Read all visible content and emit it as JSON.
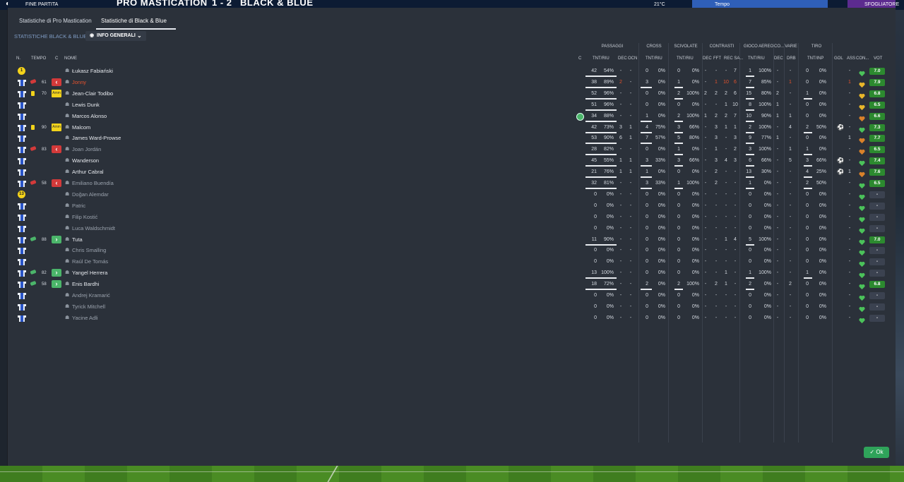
{
  "topbar": {
    "status": "FINE PARTITA",
    "home": "PRO MASTICATION",
    "score": "1 - 2",
    "away": "BLACK & BLUE",
    "right_a": "21°C",
    "right_b": "Tempo",
    "right_c": "SFOGLIATORE"
  },
  "tabs": [
    {
      "label": "Statistiche di Pro Mastication"
    },
    {
      "label": "Statistiche di Black & Blue"
    }
  ],
  "subtitle": "STATISTICHE BLACK & BLUE",
  "view_dropdown": {
    "label": "INFO GENERALI"
  },
  "groups": [
    "PASSAGGI",
    "CROSS",
    "SCIVOLATE",
    "CONTRASTI",
    "GIOCO AEREO",
    "CO...",
    "VARIE",
    "TIRO"
  ],
  "headers": {
    "n": "N.",
    "tempo": "TEMPO",
    "c": "C",
    "nome": "NOME",
    "c2": "C",
    "pass_tnt": "TNT/RIU",
    "pass_dec": "DEC",
    "pass_occ": "OCN",
    "cross": "TNT/RIU",
    "scivolate": "TNT/RIU",
    "con_dec": "DEC",
    "con_fft": "FFT",
    "con_rec": "REC SA...",
    "aereo": "TNT/RIU",
    "co_dec": "DEC",
    "varie": "DRB",
    "tiro": "TNT/INP",
    "gol": "GOL",
    "ass": "ASS",
    "con": "CON...",
    "vot": "VOT"
  },
  "players": [
    {
      "kit": "gk",
      "kitnum": "1",
      "time": "",
      "sub": "",
      "card": "",
      "name": "Łukasz Fabiański",
      "style": "",
      "p_t": "42",
      "p_r": "54%",
      "p_dec": "-",
      "p_occ": "-",
      "cr_t": "0",
      "cr_r": "0%",
      "sc_t": "0",
      "sc_r": "0%",
      "c_dec": "-",
      "c_fft": "-",
      "c_rec": "-",
      "c_sa": "7",
      "a_t": "1",
      "a_r": "100%",
      "co": "-",
      "drb": "-",
      "ti_t": "0",
      "ti_r": "0%",
      "gol": "",
      "ass": "-",
      "vot": "7.0",
      "heart": "green"
    },
    {
      "kit": "out",
      "kitnum": "",
      "time": "61",
      "sub": "out",
      "card": "",
      "name": "Jonny",
      "style": "red",
      "p_t": "38",
      "p_r": "89%",
      "p_dec": "2",
      "p_occ": "-",
      "cr_t": "3",
      "cr_r": "0%",
      "sc_t": "1",
      "sc_r": "0%",
      "c_dec": "-",
      "c_fft": "1",
      "c_rec": "10",
      "c_sa": "6",
      "a_t": "7",
      "a_r": "85%",
      "co": "-",
      "drb": "1",
      "ti_t": "0",
      "ti_r": "0%",
      "gol": "",
      "ass": "1",
      "vot": "7.9",
      "heart": "gold"
    },
    {
      "kit": "out",
      "kitnum": "",
      "time": "70",
      "sub": "amm",
      "card": "y",
      "name": "Jean-Clair Todibo",
      "style": "",
      "p_t": "52",
      "p_r": "96%",
      "p_dec": "-",
      "p_occ": "-",
      "cr_t": "0",
      "cr_r": "0%",
      "sc_t": "2",
      "sc_r": "100%",
      "c_dec": "2",
      "c_fft": "2",
      "c_rec": "2",
      "c_sa": "6",
      "a_t": "15",
      "a_r": "80%",
      "co": "2",
      "drb": "-",
      "ti_t": "1",
      "ti_r": "0%",
      "gol": "",
      "ass": "-",
      "vot": "6.8",
      "heart": "gold"
    },
    {
      "kit": "out",
      "kitnum": "",
      "time": "",
      "sub": "",
      "card": "",
      "name": "Lewis Dunk",
      "style": "",
      "p_t": "51",
      "p_r": "96%",
      "p_dec": "-",
      "p_occ": "-",
      "cr_t": "0",
      "cr_r": "0%",
      "sc_t": "0",
      "sc_r": "0%",
      "c_dec": "-",
      "c_fft": "-",
      "c_rec": "1",
      "c_sa": "10",
      "a_t": "8",
      "a_r": "100%",
      "co": "1",
      "drb": "-",
      "ti_t": "0",
      "ti_r": "0%",
      "gol": "",
      "ass": "-",
      "vot": "6.5",
      "heart": "gold"
    },
    {
      "kit": "out",
      "kitnum": "",
      "time": "",
      "sub": "",
      "card": "",
      "name": "Marcos Alonso",
      "style": "",
      "p_t": "34",
      "p_r": "88%",
      "p_dec": "-",
      "p_occ": "-",
      "cr_t": "1",
      "cr_r": "0%",
      "sc_t": "2",
      "sc_r": "100%",
      "c_dec": "1",
      "c_fft": "2",
      "c_rec": "2",
      "c_sa": "7",
      "a_t": "10",
      "a_r": "90%",
      "co": "1",
      "drb": "1",
      "ti_t": "0",
      "ti_r": "0%",
      "gol": "",
      "ass": "-",
      "vot": "6.6",
      "heart": "orange",
      "motm": true
    },
    {
      "kit": "out",
      "kitnum": "",
      "time": "90",
      "sub": "amm",
      "card": "y",
      "name": "Malcom",
      "style": "",
      "p_t": "42",
      "p_r": "73%",
      "p_dec": "3",
      "p_occ": "1",
      "cr_t": "4",
      "cr_r": "75%",
      "sc_t": "3",
      "sc_r": "66%",
      "c_dec": "-",
      "c_fft": "3",
      "c_rec": "1",
      "c_sa": "1",
      "a_t": "2",
      "a_r": "100%",
      "co": "-",
      "drb": "4",
      "ti_t": "2",
      "ti_r": "50%",
      "gol": "⚽",
      "ass": "-",
      "vot": "7.3",
      "heart": "green"
    },
    {
      "kit": "out",
      "kitnum": "",
      "time": "",
      "sub": "",
      "card": "",
      "name": "James Ward-Prowse",
      "style": "",
      "p_t": "53",
      "p_r": "90%",
      "p_dec": "6",
      "p_occ": "1",
      "cr_t": "7",
      "cr_r": "57%",
      "sc_t": "5",
      "sc_r": "80%",
      "c_dec": "-",
      "c_fft": "3",
      "c_rec": "-",
      "c_sa": "3",
      "a_t": "9",
      "a_r": "77%",
      "co": "1",
      "drb": "-",
      "ti_t": "0",
      "ti_r": "0%",
      "gol": "",
      "ass": "1",
      "vot": "7.7",
      "heart": "orange"
    },
    {
      "kit": "out",
      "kitnum": "",
      "time": "83",
      "sub": "out",
      "card": "",
      "name": "Joan Jordán",
      "style": "dim",
      "p_t": "28",
      "p_r": "82%",
      "p_dec": "-",
      "p_occ": "-",
      "cr_t": "0",
      "cr_r": "0%",
      "sc_t": "1",
      "sc_r": "0%",
      "c_dec": "-",
      "c_fft": "1",
      "c_rec": "-",
      "c_sa": "2",
      "a_t": "3",
      "a_r": "100%",
      "co": "-",
      "drb": "1",
      "ti_t": "1",
      "ti_r": "0%",
      "gol": "",
      "ass": "-",
      "vot": "6.5",
      "heart": "orange"
    },
    {
      "kit": "out",
      "kitnum": "",
      "time": "",
      "sub": "",
      "card": "",
      "name": "Wanderson",
      "style": "",
      "p_t": "45",
      "p_r": "55%",
      "p_dec": "1",
      "p_occ": "1",
      "cr_t": "3",
      "cr_r": "33%",
      "sc_t": "3",
      "sc_r": "66%",
      "c_dec": "-",
      "c_fft": "3",
      "c_rec": "4",
      "c_sa": "3",
      "a_t": "6",
      "a_r": "66%",
      "co": "-",
      "drb": "5",
      "ti_t": "3",
      "ti_r": "66%",
      "gol": "⚽",
      "ass": "-",
      "vot": "7.4",
      "heart": "green"
    },
    {
      "kit": "out",
      "kitnum": "",
      "time": "",
      "sub": "",
      "card": "",
      "name": "Arthur Cabral",
      "style": "",
      "p_t": "21",
      "p_r": "76%",
      "p_dec": "1",
      "p_occ": "1",
      "cr_t": "1",
      "cr_r": "0%",
      "sc_t": "0",
      "sc_r": "0%",
      "c_dec": "-",
      "c_fft": "2",
      "c_rec": "-",
      "c_sa": "-",
      "a_t": "13",
      "a_r": "30%",
      "co": "-",
      "drb": "-",
      "ti_t": "4",
      "ti_r": "25%",
      "gol": "⚽",
      "ass": "1",
      "vot": "7.6",
      "heart": "orange"
    },
    {
      "kit": "out",
      "kitnum": "",
      "time": "58",
      "sub": "out",
      "card": "",
      "name": "Emiliano Buendía",
      "style": "dim",
      "p_t": "32",
      "p_r": "81%",
      "p_dec": "-",
      "p_occ": "-",
      "cr_t": "3",
      "cr_r": "33%",
      "sc_t": "1",
      "sc_r": "100%",
      "c_dec": "-",
      "c_fft": "2",
      "c_rec": "-",
      "c_sa": "-",
      "a_t": "1",
      "a_r": "0%",
      "co": "-",
      "drb": "-",
      "ti_t": "2",
      "ti_r": "50%",
      "gol": "",
      "ass": "-",
      "vot": "6.5",
      "heart": "green"
    },
    {
      "kit": "gk",
      "kitnum": "13",
      "time": "",
      "sub": "",
      "card": "",
      "name": "Doğan Alemdar",
      "style": "dim",
      "p_t": "0",
      "p_r": "0%",
      "p_dec": "-",
      "p_occ": "-",
      "cr_t": "0",
      "cr_r": "0%",
      "sc_t": "0",
      "sc_r": "0%",
      "c_dec": "-",
      "c_fft": "-",
      "c_rec": "-",
      "c_sa": "-",
      "a_t": "0",
      "a_r": "0%",
      "co": "-",
      "drb": "-",
      "ti_t": "0",
      "ti_r": "0%",
      "gol": "",
      "ass": "-",
      "vot": "-",
      "heart": "green"
    },
    {
      "kit": "out",
      "kitnum": "",
      "time": "",
      "sub": "",
      "card": "",
      "name": "Patric",
      "style": "dim",
      "p_t": "0",
      "p_r": "0%",
      "p_dec": "-",
      "p_occ": "-",
      "cr_t": "0",
      "cr_r": "0%",
      "sc_t": "0",
      "sc_r": "0%",
      "c_dec": "-",
      "c_fft": "-",
      "c_rec": "-",
      "c_sa": "-",
      "a_t": "0",
      "a_r": "0%",
      "co": "-",
      "drb": "-",
      "ti_t": "0",
      "ti_r": "0%",
      "gol": "",
      "ass": "-",
      "vot": "-",
      "heart": "green"
    },
    {
      "kit": "out",
      "kitnum": "",
      "time": "",
      "sub": "",
      "card": "",
      "name": "Filip Kostić",
      "style": "dim",
      "p_t": "0",
      "p_r": "0%",
      "p_dec": "-",
      "p_occ": "-",
      "cr_t": "0",
      "cr_r": "0%",
      "sc_t": "0",
      "sc_r": "0%",
      "c_dec": "-",
      "c_fft": "-",
      "c_rec": "-",
      "c_sa": "-",
      "a_t": "0",
      "a_r": "0%",
      "co": "-",
      "drb": "-",
      "ti_t": "0",
      "ti_r": "0%",
      "gol": "",
      "ass": "-",
      "vot": "-",
      "heart": "green"
    },
    {
      "kit": "out",
      "kitnum": "",
      "time": "",
      "sub": "",
      "card": "",
      "name": "Luca Waldschmidt",
      "style": "dim",
      "p_t": "0",
      "p_r": "0%",
      "p_dec": "-",
      "p_occ": "-",
      "cr_t": "0",
      "cr_r": "0%",
      "sc_t": "0",
      "sc_r": "0%",
      "c_dec": "-",
      "c_fft": "-",
      "c_rec": "-",
      "c_sa": "-",
      "a_t": "0",
      "a_r": "0%",
      "co": "-",
      "drb": "-",
      "ti_t": "0",
      "ti_r": "0%",
      "gol": "",
      "ass": "-",
      "vot": "-",
      "heart": "green"
    },
    {
      "kit": "out",
      "kitnum": "",
      "time": "88",
      "sub": "in",
      "card": "",
      "name": "Tuta",
      "style": "",
      "p_t": "11",
      "p_r": "90%",
      "p_dec": "-",
      "p_occ": "-",
      "cr_t": "0",
      "cr_r": "0%",
      "sc_t": "0",
      "sc_r": "0%",
      "c_dec": "-",
      "c_fft": "-",
      "c_rec": "1",
      "c_sa": "4",
      "a_t": "5",
      "a_r": "100%",
      "co": "-",
      "drb": "-",
      "ti_t": "0",
      "ti_r": "0%",
      "gol": "",
      "ass": "-",
      "vot": "7.0",
      "heart": "green"
    },
    {
      "kit": "out",
      "kitnum": "",
      "time": "",
      "sub": "",
      "card": "",
      "name": "Chris Smalling",
      "style": "dim",
      "p_t": "0",
      "p_r": "0%",
      "p_dec": "-",
      "p_occ": "-",
      "cr_t": "0",
      "cr_r": "0%",
      "sc_t": "0",
      "sc_r": "0%",
      "c_dec": "-",
      "c_fft": "-",
      "c_rec": "-",
      "c_sa": "-",
      "a_t": "0",
      "a_r": "0%",
      "co": "-",
      "drb": "-",
      "ti_t": "0",
      "ti_r": "0%",
      "gol": "",
      "ass": "-",
      "vot": "-",
      "heart": "green"
    },
    {
      "kit": "out",
      "kitnum": "",
      "time": "",
      "sub": "",
      "card": "",
      "name": "Raúl De Tomás",
      "style": "dim",
      "p_t": "0",
      "p_r": "0%",
      "p_dec": "-",
      "p_occ": "-",
      "cr_t": "0",
      "cr_r": "0%",
      "sc_t": "0",
      "sc_r": "0%",
      "c_dec": "-",
      "c_fft": "-",
      "c_rec": "-",
      "c_sa": "-",
      "a_t": "0",
      "a_r": "0%",
      "co": "-",
      "drb": "-",
      "ti_t": "0",
      "ti_r": "0%",
      "gol": "",
      "ass": "-",
      "vot": "-",
      "heart": "green"
    },
    {
      "kit": "out",
      "kitnum": "",
      "time": "82",
      "sub": "in",
      "card": "",
      "name": "Yangel Herrera",
      "style": "",
      "p_t": "13",
      "p_r": "100%",
      "p_dec": "-",
      "p_occ": "-",
      "cr_t": "0",
      "cr_r": "0%",
      "sc_t": "0",
      "sc_r": "0%",
      "c_dec": "-",
      "c_fft": "-",
      "c_rec": "1",
      "c_sa": "-",
      "a_t": "1",
      "a_r": "100%",
      "co": "-",
      "drb": "-",
      "ti_t": "1",
      "ti_r": "0%",
      "gol": "",
      "ass": "-",
      "vot": "-",
      "heart": "green"
    },
    {
      "kit": "out",
      "kitnum": "",
      "time": "58",
      "sub": "in",
      "card": "",
      "name": "Enis Bardhi",
      "style": "",
      "p_t": "18",
      "p_r": "72%",
      "p_dec": "-",
      "p_occ": "-",
      "cr_t": "2",
      "cr_r": "0%",
      "sc_t": "2",
      "sc_r": "100%",
      "c_dec": "-",
      "c_fft": "2",
      "c_rec": "1",
      "c_sa": "-",
      "a_t": "2",
      "a_r": "0%",
      "co": "-",
      "drb": "2",
      "ti_t": "0",
      "ti_r": "0%",
      "gol": "",
      "ass": "-",
      "vot": "6.8",
      "heart": "green"
    },
    {
      "kit": "out",
      "kitnum": "",
      "time": "",
      "sub": "",
      "card": "",
      "name": "Andrej Kramarić",
      "style": "dim",
      "p_t": "0",
      "p_r": "0%",
      "p_dec": "-",
      "p_occ": "-",
      "cr_t": "0",
      "cr_r": "0%",
      "sc_t": "0",
      "sc_r": "0%",
      "c_dec": "-",
      "c_fft": "-",
      "c_rec": "-",
      "c_sa": "-",
      "a_t": "0",
      "a_r": "0%",
      "co": "-",
      "drb": "-",
      "ti_t": "0",
      "ti_r": "0%",
      "gol": "",
      "ass": "-",
      "vot": "-",
      "heart": "green"
    },
    {
      "kit": "out",
      "kitnum": "",
      "time": "",
      "sub": "",
      "card": "",
      "name": "Tyrick Mitchell",
      "style": "dim",
      "p_t": "0",
      "p_r": "0%",
      "p_dec": "-",
      "p_occ": "-",
      "cr_t": "0",
      "cr_r": "0%",
      "sc_t": "0",
      "sc_r": "0%",
      "c_dec": "-",
      "c_fft": "-",
      "c_rec": "-",
      "c_sa": "-",
      "a_t": "0",
      "a_r": "0%",
      "co": "-",
      "drb": "-",
      "ti_t": "0",
      "ti_r": "0%",
      "gol": "",
      "ass": "-",
      "vot": "-",
      "heart": "green"
    },
    {
      "kit": "out",
      "kitnum": "",
      "time": "",
      "sub": "",
      "card": "",
      "name": "Yacine Adli",
      "style": "dim",
      "p_t": "0",
      "p_r": "0%",
      "p_dec": "-",
      "p_occ": "-",
      "cr_t": "0",
      "cr_r": "0%",
      "sc_t": "0",
      "sc_r": "0%",
      "c_dec": "-",
      "c_fft": "-",
      "c_rec": "-",
      "c_sa": "-",
      "a_t": "0",
      "a_r": "0%",
      "co": "-",
      "drb": "-",
      "ti_t": "0",
      "ti_r": "0%",
      "gol": "",
      "ass": "-",
      "vot": "-",
      "heart": "green"
    }
  ],
  "sub_amm_label": "Amm",
  "ok_button": "Ok"
}
